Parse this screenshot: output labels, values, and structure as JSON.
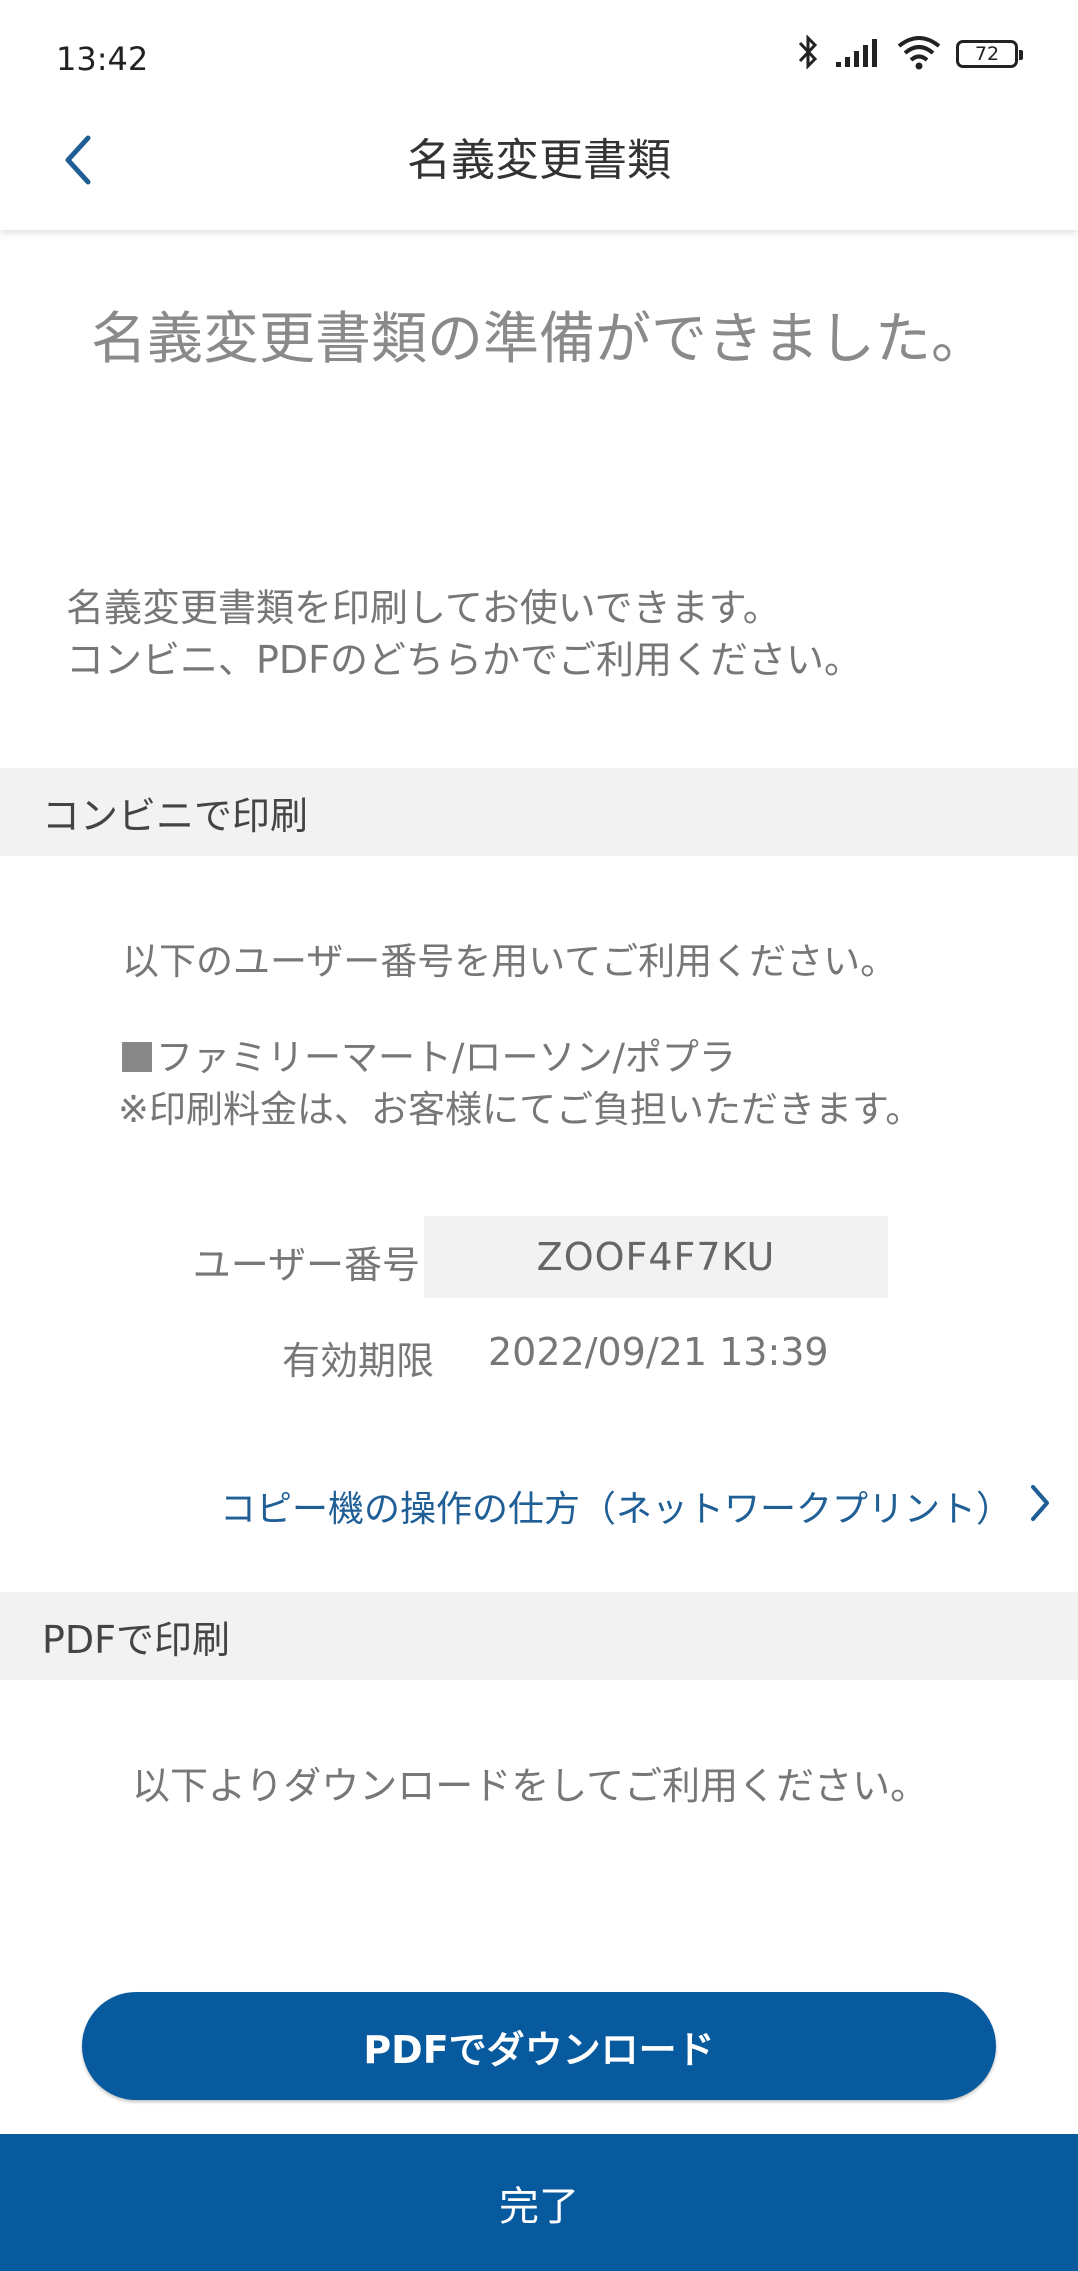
{
  "status_bar": {
    "time": "13:42",
    "battery": "72"
  },
  "header": {
    "title": "名義変更書類"
  },
  "lead": "名義変更書類の準備ができました。",
  "intro": {
    "line1": "名義変更書類を印刷してお使いできます。",
    "line2": "コンビニ、PDFのどちらかでご利用ください。"
  },
  "convenience": {
    "section_title": "コンビニで印刷",
    "instruction": "以下のユーザー番号を用いてご利用ください。",
    "stores": "ファミリーマート/ローソン/ポプラ",
    "fee_note": "※印刷料金は、お客様にてご負担いただきます。",
    "user_number_label": "ユーザー番号",
    "user_number": "ZOOF4F7KU",
    "expiry_label": "有効期限",
    "expiry": "2022/09/21 13:39",
    "help_link": "コピー機の操作の仕方（ネットワークプリント）"
  },
  "pdf": {
    "section_title": "PDFで印刷",
    "instruction": "以下よりダウンロードをしてご利用ください。",
    "download_label": "PDFでダウンロード"
  },
  "footer": {
    "done_label": "完了"
  },
  "colors": {
    "accent": "#075a9e",
    "link": "#1f5f96",
    "section_bg": "#f2f2f2"
  }
}
